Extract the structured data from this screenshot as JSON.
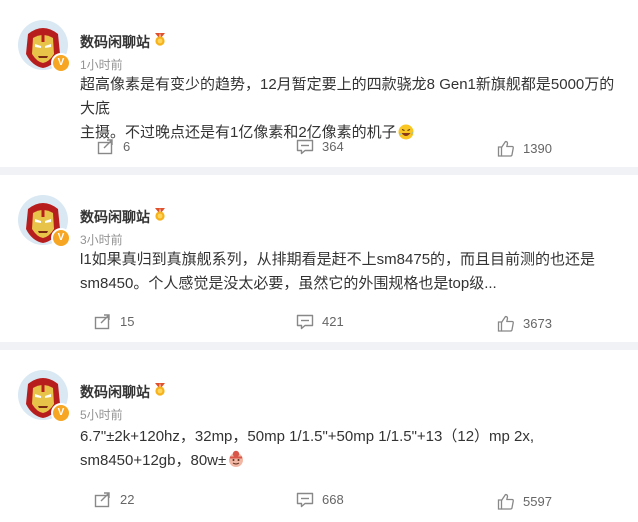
{
  "posts": [
    {
      "author": "数码闲聊站",
      "time": "1小时前",
      "line1": "超高像素是有变少的趋势，12月暂定要上的四款骁龙8 Gen1新旗舰都是5000万的大底",
      "line2": "主摄。不过晚点还是有1亿像素和2亿像素的机子",
      "emoji": "laughing-tears",
      "share": "6",
      "comment": "364",
      "like": "1390"
    },
    {
      "author": "数码闲聊站",
      "time": "3小时前",
      "line1": "l1如果真归到真旗舰系列，从排期看是赶不上sm8475的，而且目前测的也还是",
      "line2": "sm8450。个人感觉是没太必要，虽然它的外围规格也是top级...",
      "share": "15",
      "comment": "421",
      "like": "3673"
    },
    {
      "author": "数码闲聊站",
      "time": "5小时前",
      "line1": "6.7\"±2k+120hz，32mp，50mp 1/1.5\"+50mp 1/1.5\"+13（12）mp 2x,",
      "line2": "sm8450+12gb，80w±",
      "emoji": "face-emoji",
      "share": "22",
      "comment": "668",
      "like": "5597"
    }
  ],
  "colors": {
    "background": "#f1f2f5",
    "card": "#ffffff",
    "verified": "#f6a623",
    "text": "#333333",
    "meta": "#939393"
  }
}
